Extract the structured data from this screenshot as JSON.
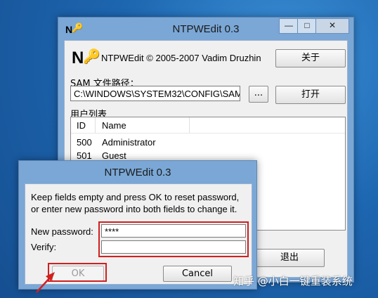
{
  "main_window": {
    "title": "NTPWEdit 0.3",
    "copyright": "NTPWEdit © 2005-2007 Vadim Druzhin",
    "about_button": "关于",
    "sam_label": "SAM 文件路径：",
    "sam_path": "C:\\WINDOWS\\SYSTEM32\\CONFIG\\SAM",
    "browse_button": "...",
    "open_button": "打开",
    "users_label": "用户列表",
    "list_columns": [
      "ID",
      "Name"
    ],
    "users": [
      {
        "id": "500",
        "name": "Administrator"
      },
      {
        "id": "501",
        "name": "Guest"
      }
    ],
    "exit_button": "退出",
    "window_buttons": {
      "minimize": "—",
      "maximize": "□",
      "close": "✕"
    }
  },
  "dialog": {
    "title": "NTPWEdit 0.3",
    "message": "Keep fields empty and press OK to reset password, or enter new password into both fields to change it.",
    "new_password_label": "New password:",
    "new_password_value": "****",
    "verify_label": "Verify:",
    "verify_value": "",
    "ok_button": "OK",
    "cancel_button": "Cancel"
  },
  "watermark": "知乎 @小白一键重装系统",
  "colors": {
    "highlight": "#d02020",
    "title_bar": "#7aa7d6"
  }
}
